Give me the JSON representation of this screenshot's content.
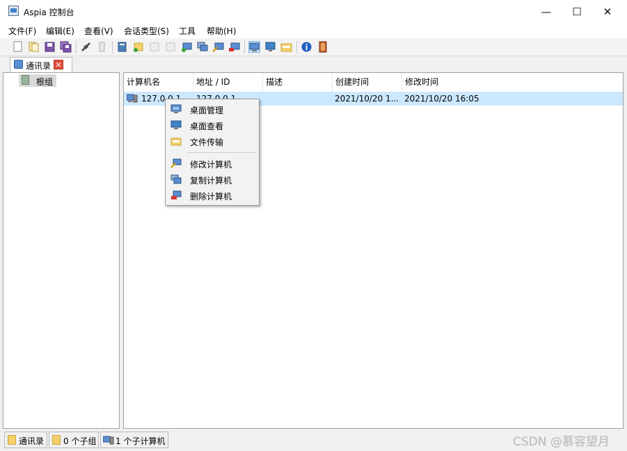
{
  "window": {
    "title": "Aspia 控制台",
    "minimize": "—",
    "maximize": "☐",
    "close": "✕"
  },
  "menu": [
    "文件(F)",
    "编辑(E)",
    "查看(V)",
    "会话类型(S)",
    "工具",
    "帮助(H)"
  ],
  "tabs": [
    {
      "label": "通讯录",
      "close": "✕"
    }
  ],
  "tree": {
    "root_label": "根组"
  },
  "columns": [
    "计算机名",
    "地址 / ID",
    "描述",
    "创建时间",
    "修改时间"
  ],
  "rows": [
    {
      "name": "127.0.0.1",
      "address": "127.0.0.1",
      "description": "",
      "created": "2021/10/20 1...",
      "modified": "2021/10/20 16:05"
    }
  ],
  "context_menu": {
    "group1": [
      "桌面管理",
      "桌面查看",
      "文件传输"
    ],
    "group2": [
      "修改计算机",
      "复制计算机",
      "删除计算机"
    ]
  },
  "status": {
    "book": "通讯录",
    "groups": "0 个子组",
    "computers": "1 个子计算机"
  },
  "watermark": "CSDN @慕容望月",
  "colors": {
    "selection": "#cce8ff",
    "toolbar_selected": "#cce4f7",
    "close_red": "#e04b3a"
  }
}
